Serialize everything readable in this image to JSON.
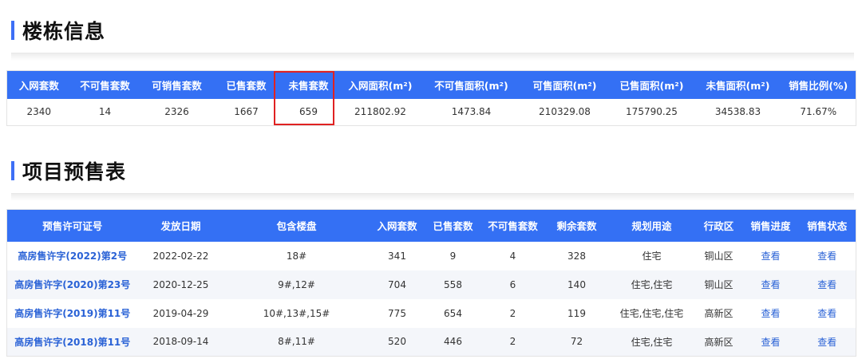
{
  "building_section": {
    "title": "楼栋信息"
  },
  "building_table": {
    "headers": [
      "入网套数",
      "不可售套数",
      "可销售套数",
      "已售套数",
      "未售套数",
      "入网面积(m²)",
      "不可售面积(m²)",
      "可售面积(m²)",
      "已售面积(m²)",
      "未售面积(m²)",
      "销售比例(%)"
    ],
    "row": [
      "2340",
      "14",
      "2326",
      "1667",
      "659",
      "211802.92",
      "1473.84",
      "210329.08",
      "175790.25",
      "34538.83",
      "71.67%"
    ]
  },
  "presale_section": {
    "title": "项目预售表"
  },
  "presale_table": {
    "headers": [
      "预售许可证号",
      "发放日期",
      "包含楼盘",
      "入网套数",
      "已售套数",
      "不可售套数",
      "剩余套数",
      "规划用途",
      "行政区",
      "销售进度",
      "销售状态"
    ],
    "rows": [
      {
        "permit": "高房售许字(2022)第2号",
        "date": "2022-02-22",
        "buildings": "18#",
        "total": "341",
        "sold": "9",
        "unsellable": "4",
        "remaining": "328",
        "usage": "住宅",
        "district": "铜山区",
        "progress": "查看",
        "status": "查看"
      },
      {
        "permit": "高房售许字(2020)第23号",
        "date": "2020-12-25",
        "buildings": "9#,12#",
        "total": "704",
        "sold": "558",
        "unsellable": "6",
        "remaining": "140",
        "usage": "住宅,住宅",
        "district": "铜山区",
        "progress": "查看",
        "status": "查看"
      },
      {
        "permit": "高房售许字(2019)第11号",
        "date": "2019-04-29",
        "buildings": "10#,13#,15#",
        "total": "775",
        "sold": "654",
        "unsellable": "2",
        "remaining": "119",
        "usage": "住宅,住宅,住宅",
        "district": "高新区",
        "progress": "查看",
        "status": "查看"
      },
      {
        "permit": "高房售许字(2018)第11号",
        "date": "2018-09-14",
        "buildings": "8#,11#",
        "total": "520",
        "sold": "446",
        "unsellable": "2",
        "remaining": "72",
        "usage": "住宅,住宅",
        "district": "高新区",
        "progress": "查看",
        "status": "查看"
      }
    ]
  },
  "colors": {
    "accent": "#3470f4",
    "highlight": "#e02222",
    "link": "#2a62d6"
  }
}
